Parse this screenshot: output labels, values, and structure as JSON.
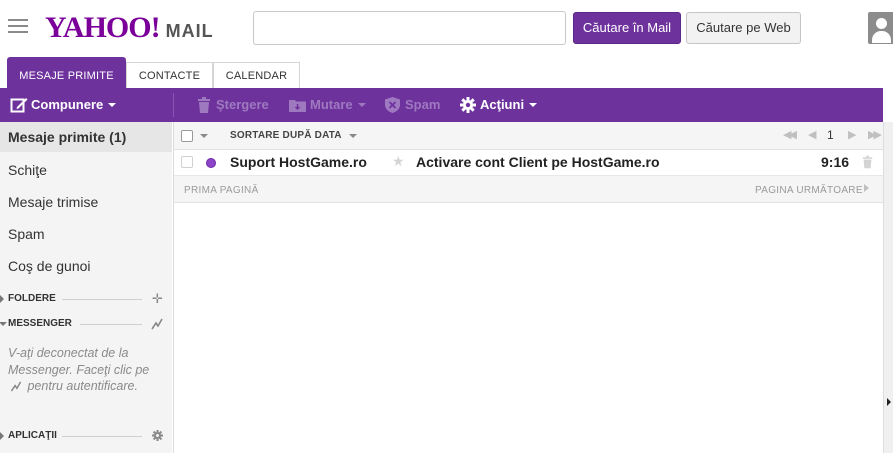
{
  "header": {
    "logo_text": "YAHOO!",
    "logo_sub": "MAIL",
    "search_value": "",
    "search_mail_label": "Căutare în Mail",
    "search_web_label": "Căutare pe Web"
  },
  "tabs": [
    {
      "label": "MESAJE PRIMITE",
      "active": true
    },
    {
      "label": "CONTACTE",
      "active": false
    },
    {
      "label": "CALENDAR",
      "active": false
    }
  ],
  "toolbar": {
    "compose_label": "Compunere",
    "delete_label": "Ştergere",
    "move_label": "Mutare",
    "spam_label": "Spam",
    "actions_label": "Acţiuni"
  },
  "sidebar": {
    "items": [
      {
        "label": "Mesaje primite (1)",
        "active": true
      },
      {
        "label": "Schiţe",
        "active": false
      },
      {
        "label": "Mesaje trimise",
        "active": false
      },
      {
        "label": "Spam",
        "active": false
      },
      {
        "label": "Coş de gunoi",
        "active": false
      }
    ],
    "folders_label": "FOLDERE",
    "messenger_label": "MESSENGER",
    "messenger_text_1": "V-aţi deconectat de la Messenger. Faceţi clic pe",
    "messenger_text_2": "pentru autentificare.",
    "apps_label": "APLICAŢII"
  },
  "list": {
    "sort_label": "SORTARE DUPĂ DATA",
    "page_number": "1",
    "first_page": "PRIMA PAGINĂ",
    "next_page": "PAGINA URMĂTOARE"
  },
  "messages": [
    {
      "sender": "Suport HostGame.ro",
      "subject": "Activare cont Client pe HostGame.ro",
      "time": "9:16",
      "unread": true
    }
  ],
  "colors": {
    "brand_purple": "#6e329d",
    "logo_purple": "#7b0099"
  }
}
